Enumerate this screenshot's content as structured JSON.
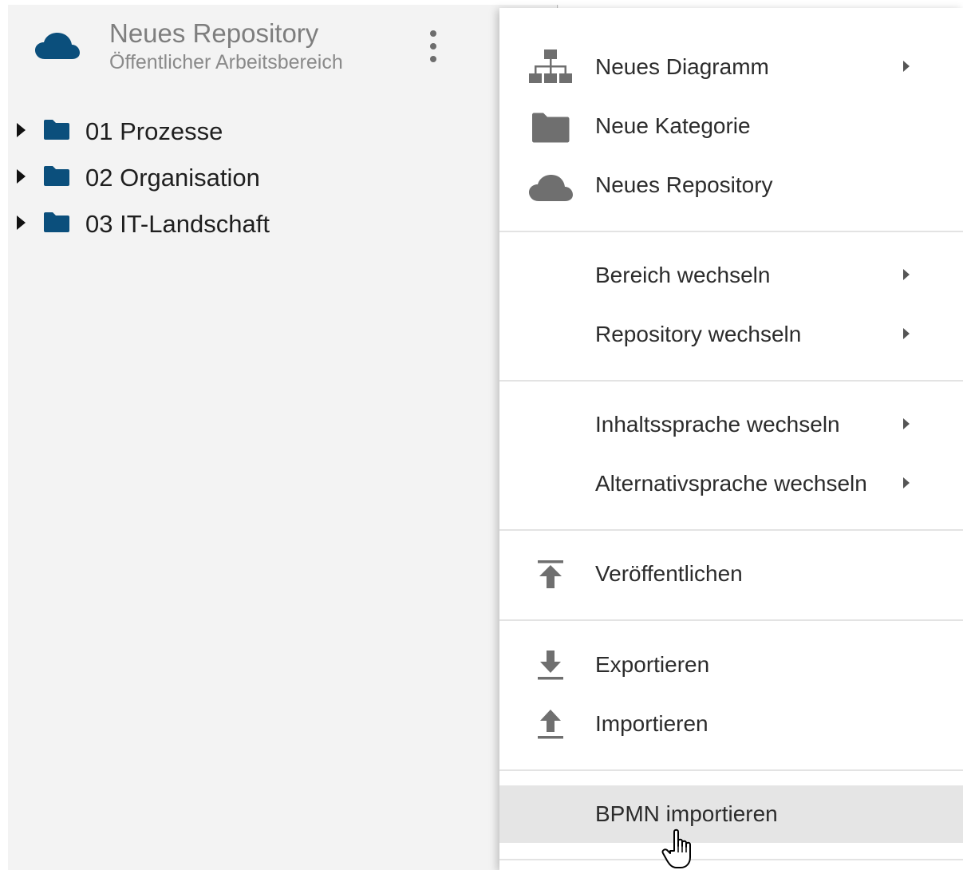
{
  "sidebar": {
    "header": {
      "title": "Neues Repository",
      "subtitle": "Öffentlicher Arbeitsbereich",
      "icon": "cloud-icon",
      "more_icon": "vertical-dots-icon"
    },
    "tree": [
      {
        "label": "01 Prozesse",
        "icon": "folder-icon"
      },
      {
        "label": "02 Organisation",
        "icon": "folder-icon"
      },
      {
        "label": "03 IT-Landschaft",
        "icon": "folder-icon"
      }
    ]
  },
  "menu": {
    "items": [
      {
        "label": "Neues Diagramm",
        "icon": "sitemap-icon",
        "submenu": true
      },
      {
        "label": "Neue Kategorie",
        "icon": "folder-icon",
        "submenu": false
      },
      {
        "label": "Neues Repository",
        "icon": "cloud-icon",
        "submenu": false
      },
      {
        "label": "Bereich wechseln",
        "icon": "",
        "submenu": true
      },
      {
        "label": "Repository wechseln",
        "icon": "",
        "submenu": true
      },
      {
        "label": "Inhaltssprache wechseln",
        "icon": "",
        "submenu": true
      },
      {
        "label": "Alternativsprache wechseln",
        "icon": "",
        "submenu": true
      },
      {
        "label": "Veröffentlichen",
        "icon": "publish-icon",
        "submenu": false
      },
      {
        "label": "Exportieren",
        "icon": "download-icon",
        "submenu": false
      },
      {
        "label": "Importieren",
        "icon": "upload-icon",
        "submenu": false
      },
      {
        "label": "BPMN importieren",
        "icon": "",
        "submenu": false,
        "hovered": true
      }
    ]
  },
  "colors": {
    "brand_blue": "#0b4f7c",
    "menu_icon_gray": "#6f6f6f",
    "hover_background": "#e5e5e5",
    "sidebar_background": "#f3f3f3"
  }
}
